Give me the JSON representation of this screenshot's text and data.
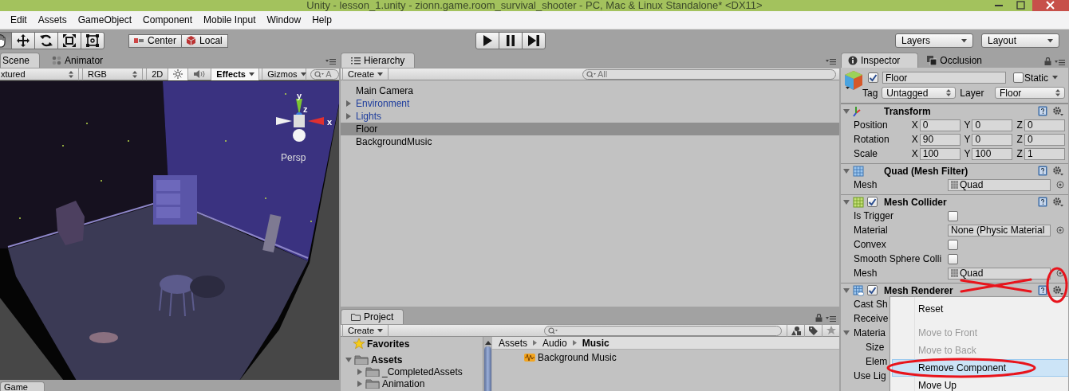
{
  "window": {
    "title": "Unity - lesson_1.unity - zionn.game.room_survival_shooter - PC, Mac & Linux Standalone* <DX11>"
  },
  "menu": [
    "Edit",
    "Assets",
    "GameObject",
    "Component",
    "Mobile Input",
    "Window",
    "Help"
  ],
  "toolbar": {
    "tools": [
      {
        "kind": "hand",
        "selected": true
      },
      {
        "kind": "move",
        "selected": false
      },
      {
        "kind": "rotate",
        "selected": false
      },
      {
        "kind": "scale",
        "selected": false
      },
      {
        "kind": "rect",
        "selected": false
      }
    ],
    "pivot": [
      {
        "kind": "pivot",
        "label": "Center"
      },
      {
        "kind": "rotation",
        "label": "Local"
      }
    ],
    "playback": [
      {
        "kind": "play"
      },
      {
        "kind": "pause"
      },
      {
        "kind": "step"
      }
    ],
    "dropdowns": [
      "Layers",
      "Layout"
    ]
  },
  "scene": {
    "tabs": [
      {
        "label": "Scene",
        "kind": "scene",
        "selected": true
      },
      {
        "label": "Animator",
        "kind": "animator",
        "selected": false
      }
    ],
    "draw_mode": "xtured",
    "render_mode": "RGB",
    "toggles": [
      {
        "kind": "dimension",
        "label": "2D",
        "on": false
      },
      {
        "kind": "lighting",
        "on": true
      },
      {
        "kind": "audio",
        "on": false
      }
    ],
    "effects": {
      "label": "Effects",
      "on": true
    },
    "gizmos": "Gizmos",
    "search_placeholder": "A",
    "gizmo_axes": [
      "y",
      "z",
      "x"
    ],
    "projection": "Persp",
    "bottom_tabs": [
      {
        "label": "Game"
      }
    ]
  },
  "hierarchy": {
    "title": "Hierarchy",
    "create": "Create",
    "search_placeholder": "All",
    "items": [
      {
        "label": "Main Camera",
        "prefab": false,
        "has_children": false,
        "selected": false
      },
      {
        "label": "Environment",
        "prefab": true,
        "has_children": true,
        "selected": false
      },
      {
        "label": "Lights",
        "prefab": true,
        "has_children": true,
        "selected": false
      },
      {
        "label": "Floor",
        "prefab": false,
        "has_children": false,
        "selected": true
      },
      {
        "label": "BackgroundMusic",
        "prefab": false,
        "has_children": false,
        "selected": false
      }
    ]
  },
  "project": {
    "title": "Project",
    "create": "Create",
    "favorites": "Favorites",
    "tree": [
      {
        "label": "Assets",
        "expanded": true,
        "children": [
          {
            "label": "_CompletedAssets",
            "expanded": false
          },
          {
            "label": "Animation",
            "expanded": false
          }
        ]
      }
    ],
    "breadcrumb": [
      "Assets",
      "Audio",
      "Music"
    ],
    "items": [
      {
        "label": "Background Music",
        "kind": "audio"
      }
    ]
  },
  "inspector": {
    "tabs": [
      {
        "label": "Inspector",
        "kind": "info",
        "selected": true
      },
      {
        "label": "Occlusion",
        "kind": "occlusion",
        "selected": false
      }
    ],
    "object": {
      "active": true,
      "name": "Floor",
      "static": false,
      "static_label": "Static",
      "tag_label": "Tag",
      "tag": "Untagged",
      "layer_label": "Layer",
      "layer": "Floor"
    },
    "components": [
      {
        "kind": "transform",
        "title": "Transform",
        "rows": [
          {
            "label": "Position",
            "kind": "vector",
            "values": [
              {
                "axis": "X",
                "value": "0"
              },
              {
                "axis": "Y",
                "value": "0"
              },
              {
                "axis": "Z",
                "value": "0"
              }
            ]
          },
          {
            "label": "Rotation",
            "kind": "vector",
            "values": [
              {
                "axis": "X",
                "value": "90"
              },
              {
                "axis": "Y",
                "value": "0"
              },
              {
                "axis": "Z",
                "value": "0"
              }
            ]
          },
          {
            "label": "Scale",
            "kind": "vector",
            "values": [
              {
                "axis": "X",
                "value": "100"
              },
              {
                "axis": "Y",
                "value": "100"
              },
              {
                "axis": "Z",
                "value": "1"
              }
            ]
          }
        ]
      },
      {
        "kind": "mesh_filter",
        "title": "Quad (Mesh Filter)",
        "rows": [
          {
            "label": "Mesh",
            "kind": "asset",
            "value": "Quad"
          }
        ]
      },
      {
        "kind": "mesh_collider",
        "title": "Mesh Collider",
        "enabled": true,
        "rows": [
          {
            "label": "Is Trigger",
            "kind": "checkbox",
            "checked": false
          },
          {
            "label": "Material",
            "kind": "object",
            "value": "None (Physic Material"
          },
          {
            "label": "Convex",
            "kind": "checkbox",
            "checked": false
          },
          {
            "label": "Smooth Sphere Colli",
            "kind": "checkbox",
            "checked": false
          },
          {
            "label": "Mesh",
            "kind": "asset",
            "value": "Quad"
          }
        ]
      },
      {
        "kind": "mesh_renderer",
        "title": "Mesh Renderer",
        "enabled": true,
        "rows": [
          {
            "label": "Cast Sh",
            "kind": "label"
          },
          {
            "label": "Receive",
            "kind": "label"
          },
          {
            "label": "Materia",
            "kind": "foldout"
          },
          {
            "label": "Size",
            "kind": "indented"
          },
          {
            "label": "Elem",
            "kind": "indented"
          },
          {
            "label": "Use Lig",
            "kind": "label"
          }
        ]
      }
    ]
  },
  "context_menu": {
    "items": [
      {
        "kind": "item",
        "label": "Reset",
        "disabled": false,
        "selected": false
      },
      {
        "kind": "separator"
      },
      {
        "kind": "item",
        "label": "Move to Front",
        "disabled": true,
        "selected": false
      },
      {
        "kind": "item",
        "label": "Move to Back",
        "disabled": true,
        "selected": false
      },
      {
        "kind": "item",
        "label": "Remove Component",
        "disabled": false,
        "selected": true
      },
      {
        "kind": "item",
        "label": "Move Up",
        "disabled": false,
        "selected": false
      }
    ]
  },
  "annotations": [
    {
      "kind": "cross"
    },
    {
      "kind": "circle"
    },
    {
      "kind": "ellipse"
    }
  ]
}
